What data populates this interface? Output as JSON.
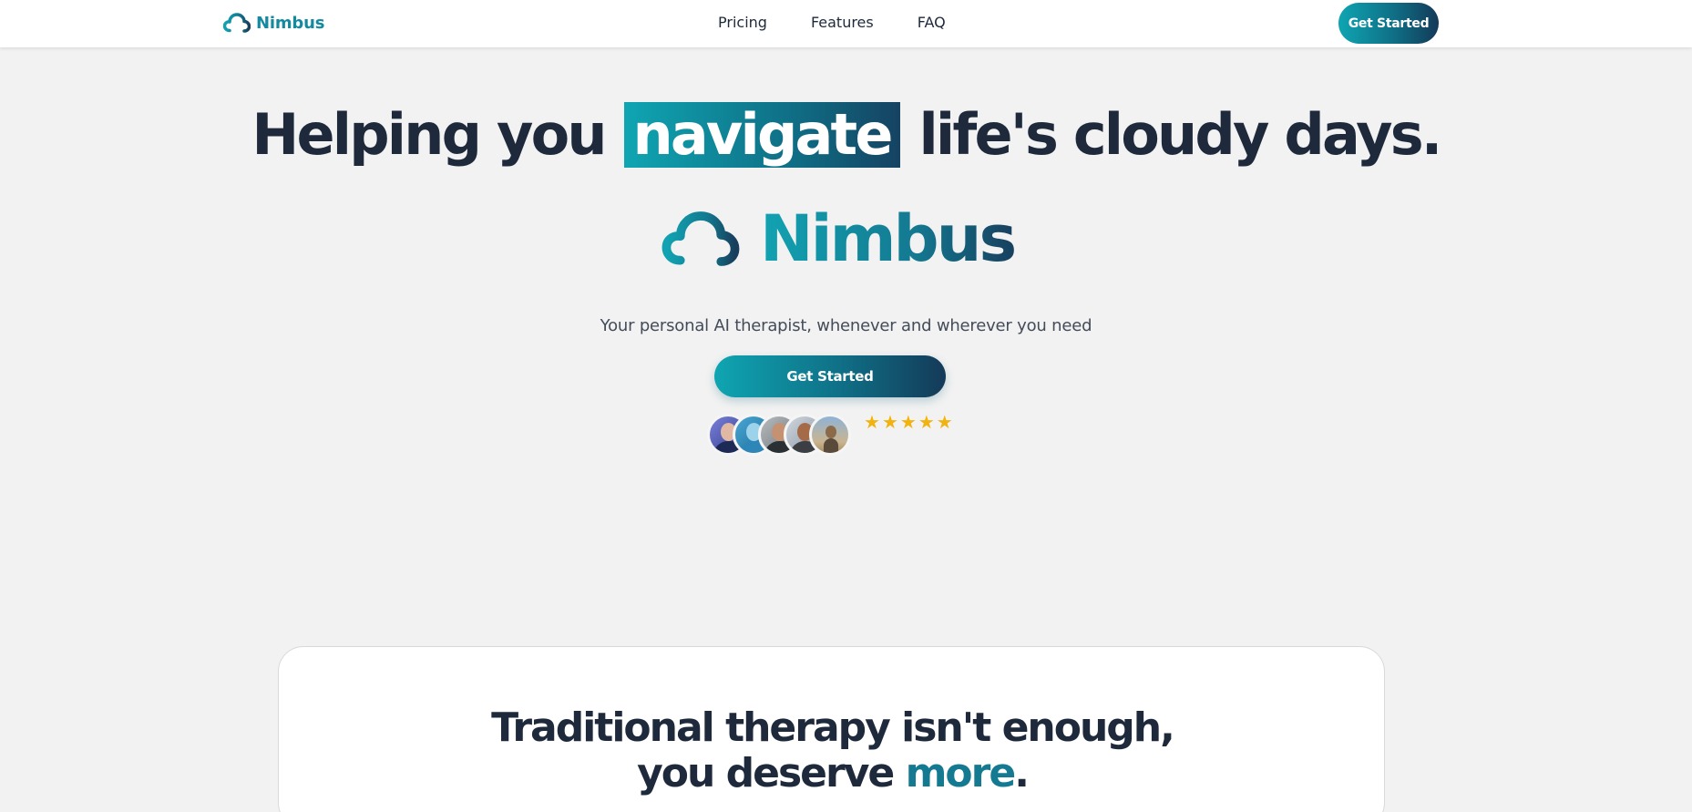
{
  "nav": {
    "brand": "Nimbus",
    "links": [
      "Pricing",
      "Features",
      "FAQ"
    ],
    "cta": "Get Started"
  },
  "hero": {
    "title_before": "Helping you",
    "title_highlight": "navigate",
    "title_after": "life's cloudy days.",
    "logo_text": "Nimbus",
    "subtitle": "Your personal AI therapist, whenever and wherever you need",
    "cta": "Get Started"
  },
  "social_proof": {
    "avatar_count": 5,
    "rating": 5,
    "star_glyph": "★"
  },
  "card": {
    "title_line1": "Traditional therapy isn't enough,",
    "title_line2_before": "you deserve",
    "title_line2_accent": "more",
    "title_line2_after": "."
  },
  "colors": {
    "brand_teal": "#0fa5b2",
    "brand_dark": "#143a58",
    "text_dark": "#1e2a3b",
    "star": "#f1b30f",
    "background": "#f2f2f2"
  },
  "icons": {
    "brand": "cloud-icon",
    "hero_logo": "cloud-icon",
    "rating": "star-icon"
  }
}
